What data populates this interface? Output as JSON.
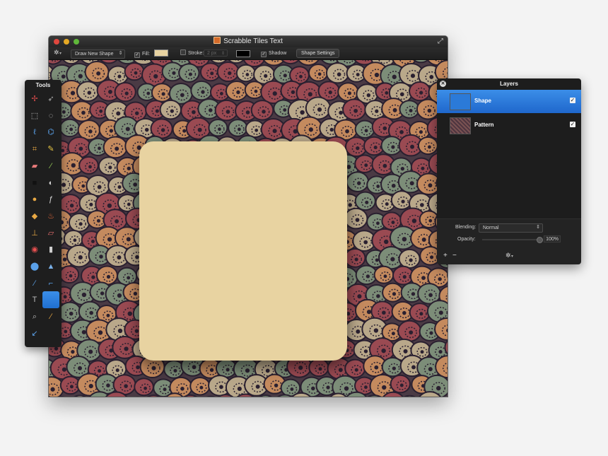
{
  "window": {
    "title": "Scrabble Tiles Text",
    "fullscreen_glyph": "⤢"
  },
  "toolbar": {
    "gear_glyph": "✲",
    "mode_select": "Draw New Shape",
    "fill_label": "Fill:",
    "fill_color": "#e8d3a1",
    "stroke_label": "Stroke:",
    "stroke_size": "2 px",
    "stroke_color": "#000000",
    "shadow_label": "Shadow",
    "shape_settings_label": "Shape Settings",
    "fill_checked": true,
    "stroke_checked": false,
    "shadow_checked": true
  },
  "tools": {
    "title": "Tools",
    "items": [
      {
        "name": "move-icon",
        "glyph": "✢"
      },
      {
        "name": "select-arrow-icon",
        "glyph": "➶"
      },
      {
        "name": "rect-select-icon",
        "glyph": "⬚"
      },
      {
        "name": "ellipse-select-icon",
        "glyph": "◌"
      },
      {
        "name": "lasso-icon",
        "glyph": "ℓ"
      },
      {
        "name": "polygon-lasso-icon",
        "glyph": "⌬"
      },
      {
        "name": "crop-icon",
        "glyph": "⌗"
      },
      {
        "name": "pencil-icon",
        "glyph": "✎"
      },
      {
        "name": "eraser-icon",
        "glyph": "▰"
      },
      {
        "name": "brush-icon",
        "glyph": "⁄"
      },
      {
        "name": "rectangle-icon",
        "glyph": "■"
      },
      {
        "name": "gradient-icon",
        "glyph": "◐"
      },
      {
        "name": "fill-icon",
        "glyph": "●"
      },
      {
        "name": "smudge-icon",
        "glyph": "ƒ"
      },
      {
        "name": "paint-bucket-icon",
        "glyph": "◆"
      },
      {
        "name": "flame-icon",
        "glyph": "♨"
      },
      {
        "name": "stamp-icon",
        "glyph": "⊥"
      },
      {
        "name": "bandage-icon",
        "glyph": "▱"
      },
      {
        "name": "eye-icon",
        "glyph": "◉"
      },
      {
        "name": "blur-icon",
        "glyph": "▮"
      },
      {
        "name": "drop-icon",
        "glyph": "⬤"
      },
      {
        "name": "sharpen-icon",
        "glyph": "▲"
      },
      {
        "name": "pen-icon",
        "glyph": "∕"
      },
      {
        "name": "path-icon",
        "glyph": "⌐"
      },
      {
        "name": "text-icon",
        "glyph": "T"
      },
      {
        "name": "shape-icon",
        "glyph": ""
      },
      {
        "name": "zoom-icon",
        "glyph": "⌕"
      },
      {
        "name": "color-picker-icon",
        "glyph": "∕"
      },
      {
        "name": "measure-icon",
        "glyph": "↙"
      }
    ]
  },
  "layers": {
    "title": "Layers",
    "items": [
      {
        "name": "Shape",
        "visible": true,
        "selected": true,
        "thumb_color": "#2b7ad8"
      },
      {
        "name": "Pattern",
        "visible": true,
        "selected": false,
        "thumb_color": "#6a4a48"
      }
    ],
    "blending_label": "Blending:",
    "blending_value": "Normal",
    "opacity_label": "Opacity:",
    "opacity_value": "100%",
    "opacity_fraction": 1.0,
    "add_glyph": "+",
    "remove_glyph": "−",
    "gear_glyph": "✲"
  },
  "colors": {
    "accent": "#2b7ad8",
    "tile": "#e8d3a1",
    "pattern_palette": [
      "#4a3a44",
      "#9a4a52",
      "#7c8d78",
      "#c48a5e",
      "#2a2030",
      "#b9a88a"
    ]
  }
}
